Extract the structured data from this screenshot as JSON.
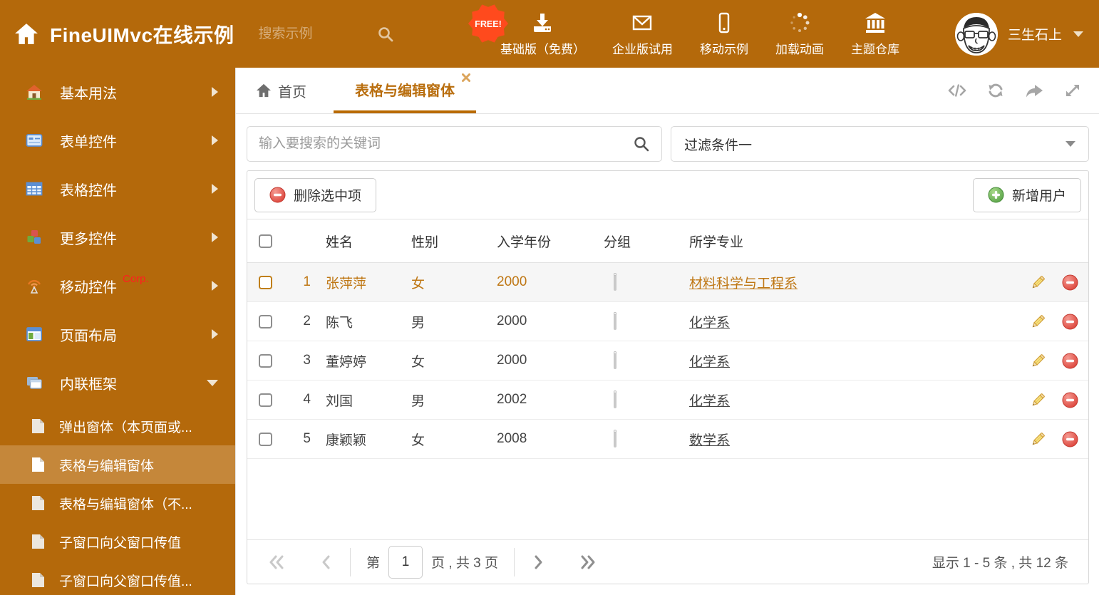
{
  "theme": {
    "orange": "#b4690b",
    "sidebar_selected": "#c5873a",
    "active_tab": "#b96e0e",
    "selected_row_text": "#bf7714",
    "free_badge_red": "#ff4a1d",
    "delete_red": "#dd3f35",
    "add_green": "#57a43c",
    "pencil_yellow": "#f9e381"
  },
  "header": {
    "title": "FineUIMvc在线示例",
    "search_placeholder": "搜索示例",
    "free_badge": "FREE!",
    "nav": [
      {
        "icon": "download-icon",
        "label": "基础版（免费）"
      },
      {
        "icon": "mail-icon",
        "label": "企业版试用"
      },
      {
        "icon": "mobile-icon",
        "label": "移动示例"
      },
      {
        "icon": "spinner-icon",
        "label": "加载动画"
      },
      {
        "icon": "bank-icon",
        "label": "主题仓库"
      }
    ],
    "username": "三生石上"
  },
  "sidebar": {
    "items": [
      {
        "label": "基本用法"
      },
      {
        "label": "表单控件"
      },
      {
        "label": "表格控件"
      },
      {
        "label": "更多控件"
      },
      {
        "label": "移动控件",
        "badge": "Corp."
      },
      {
        "label": "页面布局"
      },
      {
        "label": "内联框架"
      }
    ],
    "subitems": [
      {
        "label": "弹出窗体（本页面或..."
      },
      {
        "label": "表格与编辑窗体"
      },
      {
        "label": "表格与编辑窗体（不..."
      },
      {
        "label": "子窗口向父窗口传值"
      },
      {
        "label": "子窗口向父窗口传值..."
      }
    ]
  },
  "tabs": {
    "home_label": "首页",
    "active_label": "表格与编辑窗体"
  },
  "filters": {
    "search_placeholder": "输入要搜索的关键词",
    "filter_value": "过滤条件一"
  },
  "toolbar": {
    "delete_label": "删除选中项",
    "add_label": "新增用户"
  },
  "table": {
    "columns": [
      "姓名",
      "性别",
      "入学年份",
      "分组",
      "所学专业"
    ],
    "rows": [
      {
        "num": "1",
        "name": "张萍萍",
        "gender": "女",
        "year": "2000",
        "group_color": "#8ecdf5",
        "major": "材料科学与工程系"
      },
      {
        "num": "2",
        "name": "陈飞",
        "gender": "男",
        "year": "2000",
        "group_color": "#8ecdf5",
        "major": "化学系"
      },
      {
        "num": "3",
        "name": "董婷婷",
        "gender": "女",
        "year": "2000",
        "group_color": "#a4d36c",
        "major": "化学系"
      },
      {
        "num": "4",
        "name": "刘国",
        "gender": "男",
        "year": "2002",
        "group_color": "#a4d36c",
        "major": "化学系"
      },
      {
        "num": "5",
        "name": "康颖颖",
        "gender": "女",
        "year": "2008",
        "group_color": "#f8b36a",
        "major": "数学系"
      }
    ]
  },
  "pagination": {
    "page_label_prefix": "第",
    "page": "1",
    "page_label_suffix": "页 , 共 3 页",
    "summary": "显示 1 - 5 条 , 共 12 条"
  }
}
